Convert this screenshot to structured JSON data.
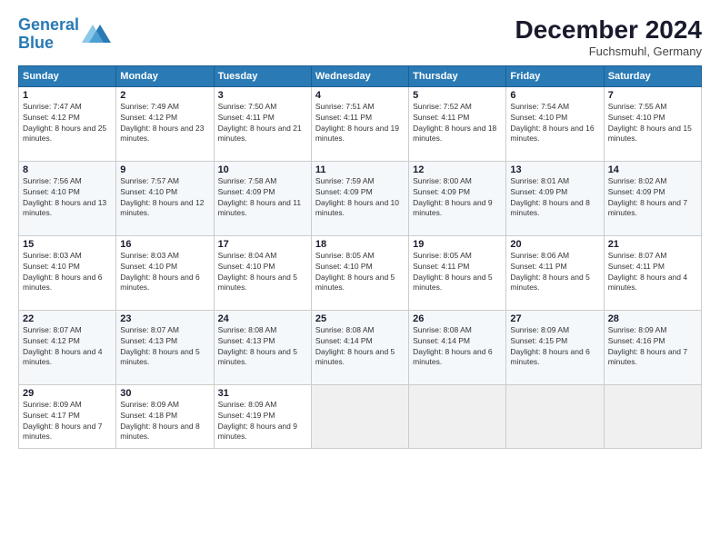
{
  "header": {
    "logo_line1": "General",
    "logo_line2": "Blue",
    "month": "December 2024",
    "location": "Fuchsmuhl, Germany"
  },
  "days_of_week": [
    "Sunday",
    "Monday",
    "Tuesday",
    "Wednesday",
    "Thursday",
    "Friday",
    "Saturday"
  ],
  "weeks": [
    [
      {
        "day": "1",
        "sunrise": "7:47 AM",
        "sunset": "4:12 PM",
        "daylight": "8 hours and 25 minutes."
      },
      {
        "day": "2",
        "sunrise": "7:49 AM",
        "sunset": "4:12 PM",
        "daylight": "8 hours and 23 minutes."
      },
      {
        "day": "3",
        "sunrise": "7:50 AM",
        "sunset": "4:11 PM",
        "daylight": "8 hours and 21 minutes."
      },
      {
        "day": "4",
        "sunrise": "7:51 AM",
        "sunset": "4:11 PM",
        "daylight": "8 hours and 19 minutes."
      },
      {
        "day": "5",
        "sunrise": "7:52 AM",
        "sunset": "4:11 PM",
        "daylight": "8 hours and 18 minutes."
      },
      {
        "day": "6",
        "sunrise": "7:54 AM",
        "sunset": "4:10 PM",
        "daylight": "8 hours and 16 minutes."
      },
      {
        "day": "7",
        "sunrise": "7:55 AM",
        "sunset": "4:10 PM",
        "daylight": "8 hours and 15 minutes."
      }
    ],
    [
      {
        "day": "8",
        "sunrise": "7:56 AM",
        "sunset": "4:10 PM",
        "daylight": "8 hours and 13 minutes."
      },
      {
        "day": "9",
        "sunrise": "7:57 AM",
        "sunset": "4:10 PM",
        "daylight": "8 hours and 12 minutes."
      },
      {
        "day": "10",
        "sunrise": "7:58 AM",
        "sunset": "4:09 PM",
        "daylight": "8 hours and 11 minutes."
      },
      {
        "day": "11",
        "sunrise": "7:59 AM",
        "sunset": "4:09 PM",
        "daylight": "8 hours and 10 minutes."
      },
      {
        "day": "12",
        "sunrise": "8:00 AM",
        "sunset": "4:09 PM",
        "daylight": "8 hours and 9 minutes."
      },
      {
        "day": "13",
        "sunrise": "8:01 AM",
        "sunset": "4:09 PM",
        "daylight": "8 hours and 8 minutes."
      },
      {
        "day": "14",
        "sunrise": "8:02 AM",
        "sunset": "4:09 PM",
        "daylight": "8 hours and 7 minutes."
      }
    ],
    [
      {
        "day": "15",
        "sunrise": "8:03 AM",
        "sunset": "4:10 PM",
        "daylight": "8 hours and 6 minutes."
      },
      {
        "day": "16",
        "sunrise": "8:03 AM",
        "sunset": "4:10 PM",
        "daylight": "8 hours and 6 minutes."
      },
      {
        "day": "17",
        "sunrise": "8:04 AM",
        "sunset": "4:10 PM",
        "daylight": "8 hours and 5 minutes."
      },
      {
        "day": "18",
        "sunrise": "8:05 AM",
        "sunset": "4:10 PM",
        "daylight": "8 hours and 5 minutes."
      },
      {
        "day": "19",
        "sunrise": "8:05 AM",
        "sunset": "4:11 PM",
        "daylight": "8 hours and 5 minutes."
      },
      {
        "day": "20",
        "sunrise": "8:06 AM",
        "sunset": "4:11 PM",
        "daylight": "8 hours and 5 minutes."
      },
      {
        "day": "21",
        "sunrise": "8:07 AM",
        "sunset": "4:11 PM",
        "daylight": "8 hours and 4 minutes."
      }
    ],
    [
      {
        "day": "22",
        "sunrise": "8:07 AM",
        "sunset": "4:12 PM",
        "daylight": "8 hours and 4 minutes."
      },
      {
        "day": "23",
        "sunrise": "8:07 AM",
        "sunset": "4:13 PM",
        "daylight": "8 hours and 5 minutes."
      },
      {
        "day": "24",
        "sunrise": "8:08 AM",
        "sunset": "4:13 PM",
        "daylight": "8 hours and 5 minutes."
      },
      {
        "day": "25",
        "sunrise": "8:08 AM",
        "sunset": "4:14 PM",
        "daylight": "8 hours and 5 minutes."
      },
      {
        "day": "26",
        "sunrise": "8:08 AM",
        "sunset": "4:14 PM",
        "daylight": "8 hours and 6 minutes."
      },
      {
        "day": "27",
        "sunrise": "8:09 AM",
        "sunset": "4:15 PM",
        "daylight": "8 hours and 6 minutes."
      },
      {
        "day": "28",
        "sunrise": "8:09 AM",
        "sunset": "4:16 PM",
        "daylight": "8 hours and 7 minutes."
      }
    ],
    [
      {
        "day": "29",
        "sunrise": "8:09 AM",
        "sunset": "4:17 PM",
        "daylight": "8 hours and 7 minutes."
      },
      {
        "day": "30",
        "sunrise": "8:09 AM",
        "sunset": "4:18 PM",
        "daylight": "8 hours and 8 minutes."
      },
      {
        "day": "31",
        "sunrise": "8:09 AM",
        "sunset": "4:19 PM",
        "daylight": "8 hours and 9 minutes."
      },
      null,
      null,
      null,
      null
    ]
  ]
}
